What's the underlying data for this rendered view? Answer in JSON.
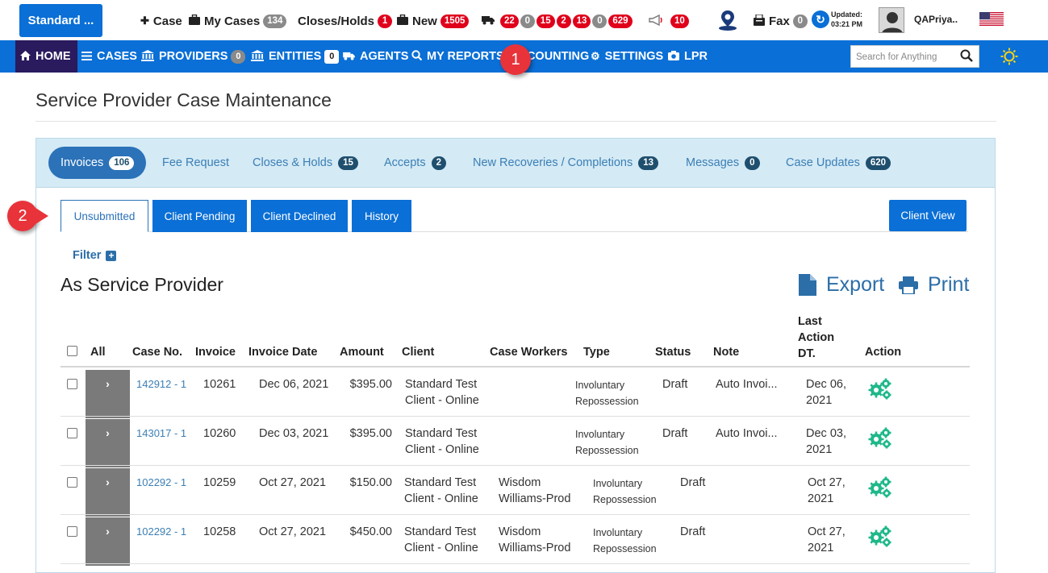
{
  "topbar": {
    "brand_label": "Standard ...",
    "case_label": "Case",
    "my_cases_label": "My Cases",
    "my_cases_count": "134",
    "closes_holds_label": "Closes/Holds",
    "closes_holds_count": "1",
    "new_label": "New",
    "new_count": "1505",
    "truck_counts": [
      "22",
      "0",
      "15",
      "2",
      "13",
      "0",
      "629"
    ],
    "announce_count": "10",
    "fax_label": "Fax",
    "fax_count": "0",
    "updated_label": "Updated:",
    "updated_time": "03:21 PM",
    "username": "QAPriya.."
  },
  "nav": {
    "home": "HOME",
    "cases": "CASES",
    "providers": "PROVIDERS",
    "providers_count": "0",
    "entities": "ENTITIES",
    "entities_count": "0",
    "agents": "AGENTS",
    "my_reports": "MY REPORTS",
    "accounting": "ACCOUNTING",
    "settings": "SETTINGS",
    "lpr": "LPR",
    "search_placeholder": "Search for Anything"
  },
  "callouts": {
    "one": "1",
    "two": "2"
  },
  "page": {
    "title": "Service Provider Case Maintenance",
    "section_title": "As Service Provider",
    "filter_label": "Filter",
    "export_label": "Export",
    "print_label": "Print",
    "client_view_label": "Client View"
  },
  "panel_tabs": [
    {
      "label": "Invoices",
      "count": "106"
    },
    {
      "label": "Fee Request",
      "count": ""
    },
    {
      "label": "Closes & Holds",
      "count": "15"
    },
    {
      "label": "Accepts",
      "count": "2"
    },
    {
      "label": "New Recoveries / Completions",
      "count": "13"
    },
    {
      "label": "Messages",
      "count": "0"
    },
    {
      "label": "Case Updates",
      "count": "620"
    }
  ],
  "sub_tabs": [
    "Unsubmitted",
    "Client Pending",
    "Client Declined",
    "History"
  ],
  "table": {
    "headers": {
      "all": "All",
      "case_no": "Case No.",
      "invoice": "Invoice",
      "invoice_date": "Invoice Date",
      "amount": "Amount",
      "client": "Client",
      "case_workers": "Case Workers",
      "type": "Type",
      "status": "Status",
      "note": "Note",
      "last_action_1": "Last",
      "last_action_2": "Action",
      "last_action_3": "DT.",
      "action": "Action"
    },
    "rows": [
      {
        "case_no": "142912 - 1",
        "invoice": "10261",
        "invoice_date": "Dec 06, 2021",
        "amount": "$395.00",
        "client_1": "Standard Test",
        "client_2": "Client - Online",
        "worker_1": "",
        "worker_2": "",
        "type_1": "Involuntary",
        "type_2": "Repossession",
        "status": "Draft",
        "note": "Auto Invoi...",
        "last_1": "Dec 06,",
        "last_2": "2021"
      },
      {
        "case_no": "143017 - 1",
        "invoice": "10260",
        "invoice_date": "Dec 03, 2021",
        "amount": "$395.00",
        "client_1": "Standard Test",
        "client_2": "Client - Online",
        "worker_1": "",
        "worker_2": "",
        "type_1": "Involuntary",
        "type_2": "Repossession",
        "status": "Draft",
        "note": "Auto Invoi...",
        "last_1": "Dec 03,",
        "last_2": "2021"
      },
      {
        "case_no": "102292 - 1",
        "invoice": "10259",
        "invoice_date": "Oct 27, 2021",
        "amount": "$150.00",
        "client_1": "Standard Test",
        "client_2": "Client - Online",
        "worker_1": "Wisdom",
        "worker_2": "Williams-Prod",
        "type_1": "Involuntary",
        "type_2": "Repossession",
        "status": "Draft",
        "note": "",
        "last_1": "Oct 27,",
        "last_2": "2021"
      },
      {
        "case_no": "102292 - 1",
        "invoice": "10258",
        "invoice_date": "Oct 27, 2021",
        "amount": "$450.00",
        "client_1": "Standard Test",
        "client_2": "Client - Online",
        "worker_1": "Wisdom",
        "worker_2": "Williams-Prod",
        "type_1": "Involuntary",
        "type_2": "Repossession",
        "status": "Draft",
        "note": "",
        "last_1": "Oct 27,",
        "last_2": "2021"
      }
    ]
  },
  "colors": {
    "primary": "#0a6fd6",
    "nav_home_bg": "#2a1a5e",
    "badge_red": "#e0001b",
    "badge_gray": "#8a8a8a",
    "callout_red": "#e8333a",
    "panel_head_bg": "#d4eaf5",
    "gear_green": "#1fb88a",
    "link_blue": "#3b7fb5"
  },
  "icons": [
    "plus-icon",
    "briefcase-icon",
    "truck-icon",
    "megaphone-icon",
    "map-pin-icon",
    "fax-icon",
    "refresh-icon",
    "user-avatar",
    "us-flag-icon",
    "home-icon",
    "menu-icon",
    "bank-icon",
    "search-icon",
    "gear-icon",
    "camera-icon",
    "sun-icon",
    "file-icon",
    "printer-icon",
    "cogs-icon"
  ]
}
